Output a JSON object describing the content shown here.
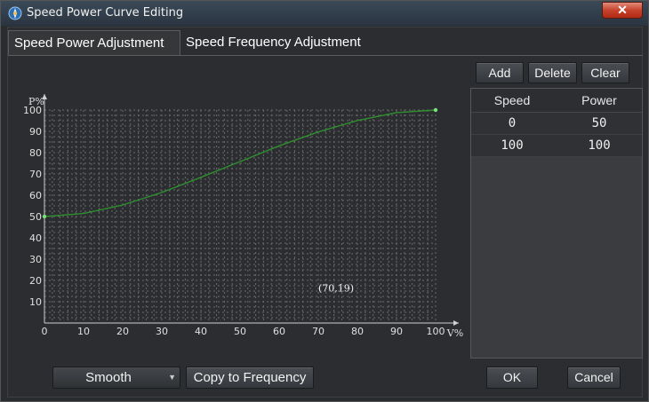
{
  "window": {
    "title": "Speed Power Curve Editing",
    "close_label": "✕"
  },
  "tabs": [
    {
      "label": "Speed Power Adjustment"
    },
    {
      "label": "Speed Frequency Adjustment"
    }
  ],
  "toolbar": {
    "add_label": "Add",
    "delete_label": "Delete",
    "clear_label": "Clear"
  },
  "table": {
    "headers": [
      "Speed",
      "Power"
    ],
    "rows": [
      [
        "0",
        "50"
      ],
      [
        "100",
        "100"
      ]
    ]
  },
  "chart_data": {
    "type": "line",
    "xlabel": "V%",
    "ylabel": "P%",
    "xlim": [
      0,
      100
    ],
    "ylim": [
      0,
      100
    ],
    "x_ticks": [
      0,
      10,
      20,
      30,
      40,
      50,
      60,
      70,
      80,
      90,
      100
    ],
    "y_ticks": [
      10,
      20,
      30,
      40,
      50,
      60,
      70,
      80,
      90,
      100
    ],
    "grid": true,
    "series": [
      {
        "x": [
          0,
          10,
          20,
          30,
          40,
          50,
          60,
          70,
          80,
          90,
          100
        ],
        "y": [
          50,
          51.4,
          55.4,
          61.3,
          68.4,
          75.8,
          83.2,
          89.7,
          95.1,
          98.8,
          100
        ]
      }
    ],
    "control_points": [
      {
        "x": 0,
        "y": 50
      },
      {
        "x": 100,
        "y": 100
      }
    ],
    "cursor_readout": "(70,19)",
    "colors": {
      "line": "#2f8f2f",
      "point": "#7de07d",
      "grid": "#6a6a6a",
      "axis": "#d0d0d0",
      "background": "#2b2d30"
    }
  },
  "bottom": {
    "mode": {
      "selected": "Smooth"
    },
    "copy_label": "Copy to Frequency",
    "ok_label": "OK",
    "cancel_label": "Cancel"
  }
}
